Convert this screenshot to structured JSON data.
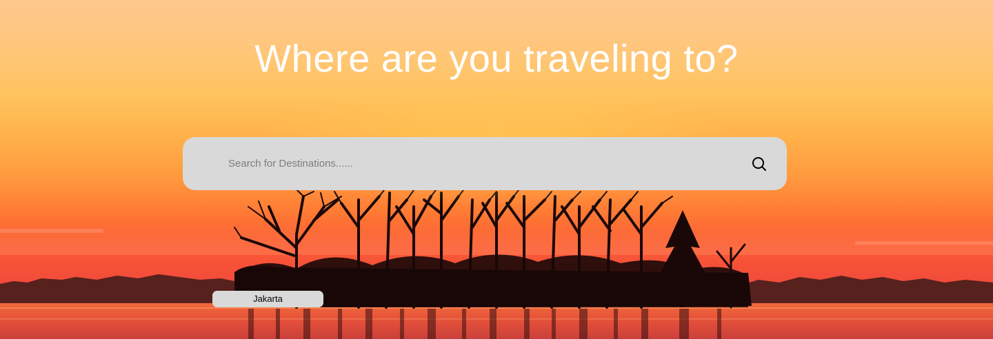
{
  "hero": {
    "title": "Where are you traveling to?"
  },
  "search": {
    "placeholder": "Search for Destinations......",
    "value": "",
    "button_icon": "search-icon"
  },
  "suggestions": [
    {
      "label": "Jakarta"
    }
  ],
  "colors": {
    "search_bg": "#d9d9d9",
    "title_text": "#ffffff",
    "sky_top": "#fec78e",
    "sky_horizon": "#f65138"
  }
}
